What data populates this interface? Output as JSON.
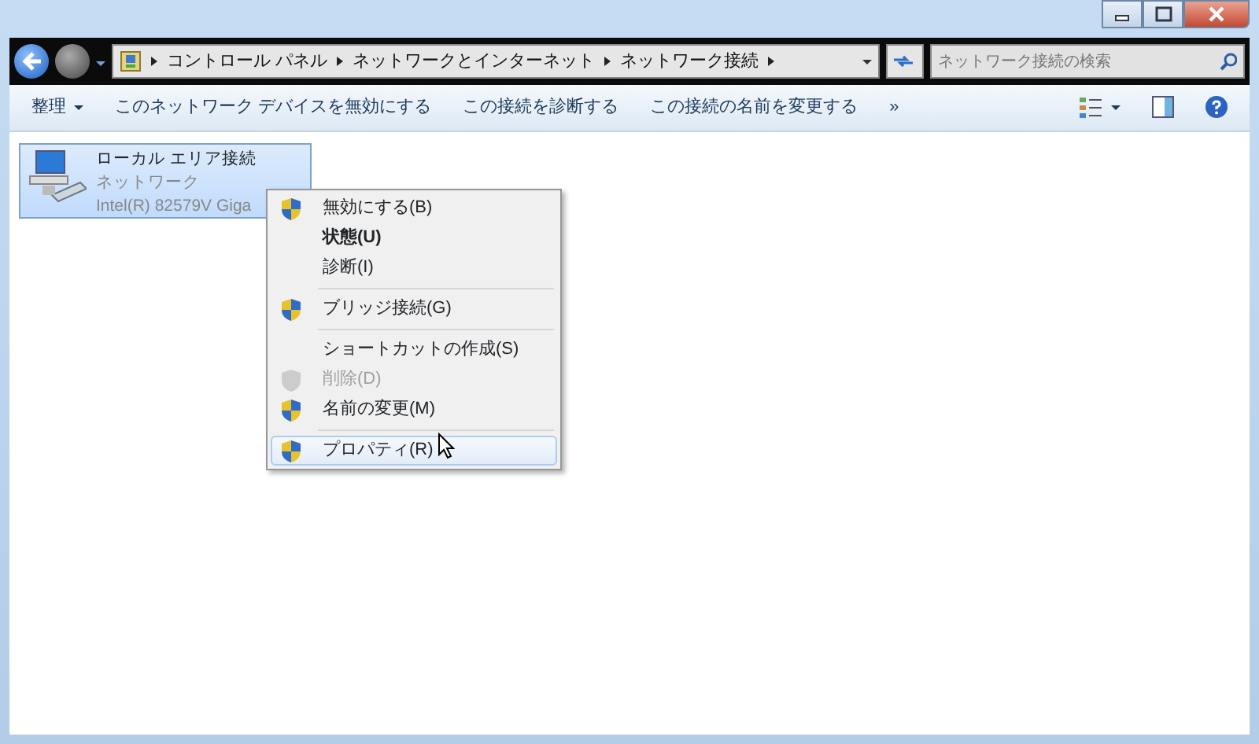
{
  "window": {
    "controls": [
      {
        "kind": "minimize"
      },
      {
        "kind": "maximize"
      },
      {
        "kind": "close"
      }
    ]
  },
  "address_bar": {
    "crumbs": [
      "コントロール パネル",
      "ネットワークとインターネット",
      "ネットワーク接続"
    ]
  },
  "search": {
    "placeholder": "ネットワーク接続の検索"
  },
  "toolbar": {
    "items": [
      {
        "label": "整理",
        "dropdown": true
      },
      {
        "label": "このネットワーク デバイスを無効にする",
        "dropdown": false
      },
      {
        "label": "この接続を診断する",
        "dropdown": false
      },
      {
        "label": "この接続の名前を変更する",
        "dropdown": false
      },
      {
        "label": "»",
        "dropdown": false
      }
    ]
  },
  "connections": [
    {
      "name": "ローカル エリア接続",
      "status": "ネットワーク",
      "device": "Intel(R) 82579V Giga",
      "selected": true
    }
  ],
  "context_menu": [
    {
      "kind": "item",
      "label": "無効にする(B)",
      "shield": true,
      "bold": false,
      "disabled": false,
      "selected": false
    },
    {
      "kind": "item",
      "label": "状態(U)",
      "shield": false,
      "bold": true,
      "disabled": false,
      "selected": false
    },
    {
      "kind": "item",
      "label": "診断(I)",
      "shield": false,
      "bold": false,
      "disabled": false,
      "selected": false
    },
    {
      "kind": "separator"
    },
    {
      "kind": "item",
      "label": "ブリッジ接続(G)",
      "shield": true,
      "bold": false,
      "disabled": false,
      "selected": false
    },
    {
      "kind": "separator"
    },
    {
      "kind": "item",
      "label": "ショートカットの作成(S)",
      "shield": false,
      "bold": false,
      "disabled": false,
      "selected": false
    },
    {
      "kind": "item",
      "label": "削除(D)",
      "shield": true,
      "bold": false,
      "disabled": true,
      "selected": false
    },
    {
      "kind": "item",
      "label": "名前の変更(M)",
      "shield": true,
      "bold": false,
      "disabled": false,
      "selected": false
    },
    {
      "kind": "separator"
    },
    {
      "kind": "item",
      "label": "プロパティ(R)",
      "shield": true,
      "bold": false,
      "disabled": false,
      "selected": true
    }
  ]
}
